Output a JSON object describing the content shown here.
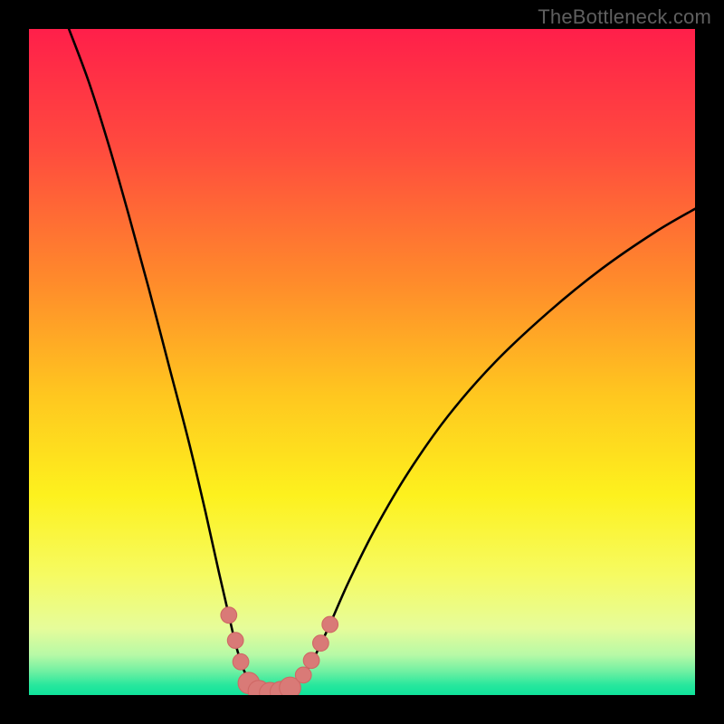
{
  "colors": {
    "frame": "#000000",
    "watermark": "#5f5f5f",
    "curve": "#000000",
    "marker_fill": "#d97a77",
    "marker_stroke": "#cf6865",
    "gradient_stops": [
      {
        "offset": 0.0,
        "color": "#ff1f4a"
      },
      {
        "offset": 0.18,
        "color": "#ff4b3e"
      },
      {
        "offset": 0.38,
        "color": "#ff8b2b"
      },
      {
        "offset": 0.55,
        "color": "#ffc71f"
      },
      {
        "offset": 0.7,
        "color": "#fdf11e"
      },
      {
        "offset": 0.82,
        "color": "#f6fb62"
      },
      {
        "offset": 0.9,
        "color": "#e6fc9a"
      },
      {
        "offset": 0.94,
        "color": "#b7f9a6"
      },
      {
        "offset": 0.965,
        "color": "#6ef0a2"
      },
      {
        "offset": 0.985,
        "color": "#28e79d"
      },
      {
        "offset": 1.0,
        "color": "#0fe39b"
      }
    ]
  },
  "watermark": "TheBottleneck.com",
  "chart_data": {
    "type": "line",
    "title": "",
    "xlabel": "",
    "ylabel": "",
    "xlim": [
      0,
      100
    ],
    "ylim": [
      0,
      100
    ],
    "note": "Axes are unlabeled in the source image. Values below are normalized 0–100 (percentage of plot width/height); x runs left→right, y runs bottom→top. Curve and marker positions are estimated from pixel positions.",
    "series": [
      {
        "name": "bottleneck-curve",
        "points": [
          {
            "x": 6.0,
            "y": 100.0
          },
          {
            "x": 9.0,
            "y": 92.0
          },
          {
            "x": 12.0,
            "y": 82.5
          },
          {
            "x": 15.0,
            "y": 72.0
          },
          {
            "x": 18.0,
            "y": 61.0
          },
          {
            "x": 21.0,
            "y": 49.5
          },
          {
            "x": 24.0,
            "y": 38.0
          },
          {
            "x": 26.5,
            "y": 27.5
          },
          {
            "x": 28.5,
            "y": 18.5
          },
          {
            "x": 30.0,
            "y": 12.0
          },
          {
            "x": 31.2,
            "y": 7.0
          },
          {
            "x": 32.5,
            "y": 3.2
          },
          {
            "x": 34.0,
            "y": 1.2
          },
          {
            "x": 35.5,
            "y": 0.4
          },
          {
            "x": 37.0,
            "y": 0.3
          },
          {
            "x": 38.5,
            "y": 0.6
          },
          {
            "x": 40.0,
            "y": 1.6
          },
          {
            "x": 41.5,
            "y": 3.4
          },
          {
            "x": 43.0,
            "y": 6.0
          },
          {
            "x": 45.0,
            "y": 10.2
          },
          {
            "x": 48.0,
            "y": 17.0
          },
          {
            "x": 52.0,
            "y": 25.0
          },
          {
            "x": 57.0,
            "y": 33.5
          },
          {
            "x": 63.0,
            "y": 42.0
          },
          {
            "x": 70.0,
            "y": 50.0
          },
          {
            "x": 78.0,
            "y": 57.5
          },
          {
            "x": 86.0,
            "y": 64.0
          },
          {
            "x": 94.0,
            "y": 69.5
          },
          {
            "x": 100.0,
            "y": 73.0
          }
        ]
      }
    ],
    "markers": [
      {
        "x": 30.0,
        "y": 12.0,
        "r": 1.2
      },
      {
        "x": 31.0,
        "y": 8.2,
        "r": 1.2
      },
      {
        "x": 31.8,
        "y": 5.0,
        "r": 1.2
      },
      {
        "x": 33.0,
        "y": 1.8,
        "r": 1.6
      },
      {
        "x": 34.5,
        "y": 0.6,
        "r": 1.6
      },
      {
        "x": 36.2,
        "y": 0.3,
        "r": 1.6
      },
      {
        "x": 37.8,
        "y": 0.45,
        "r": 1.6
      },
      {
        "x": 39.2,
        "y": 1.1,
        "r": 1.6
      },
      {
        "x": 41.2,
        "y": 3.0,
        "r": 1.2
      },
      {
        "x": 42.4,
        "y": 5.2,
        "r": 1.2
      },
      {
        "x": 43.8,
        "y": 7.8,
        "r": 1.2
      },
      {
        "x": 45.2,
        "y": 10.6,
        "r": 1.2
      }
    ]
  }
}
